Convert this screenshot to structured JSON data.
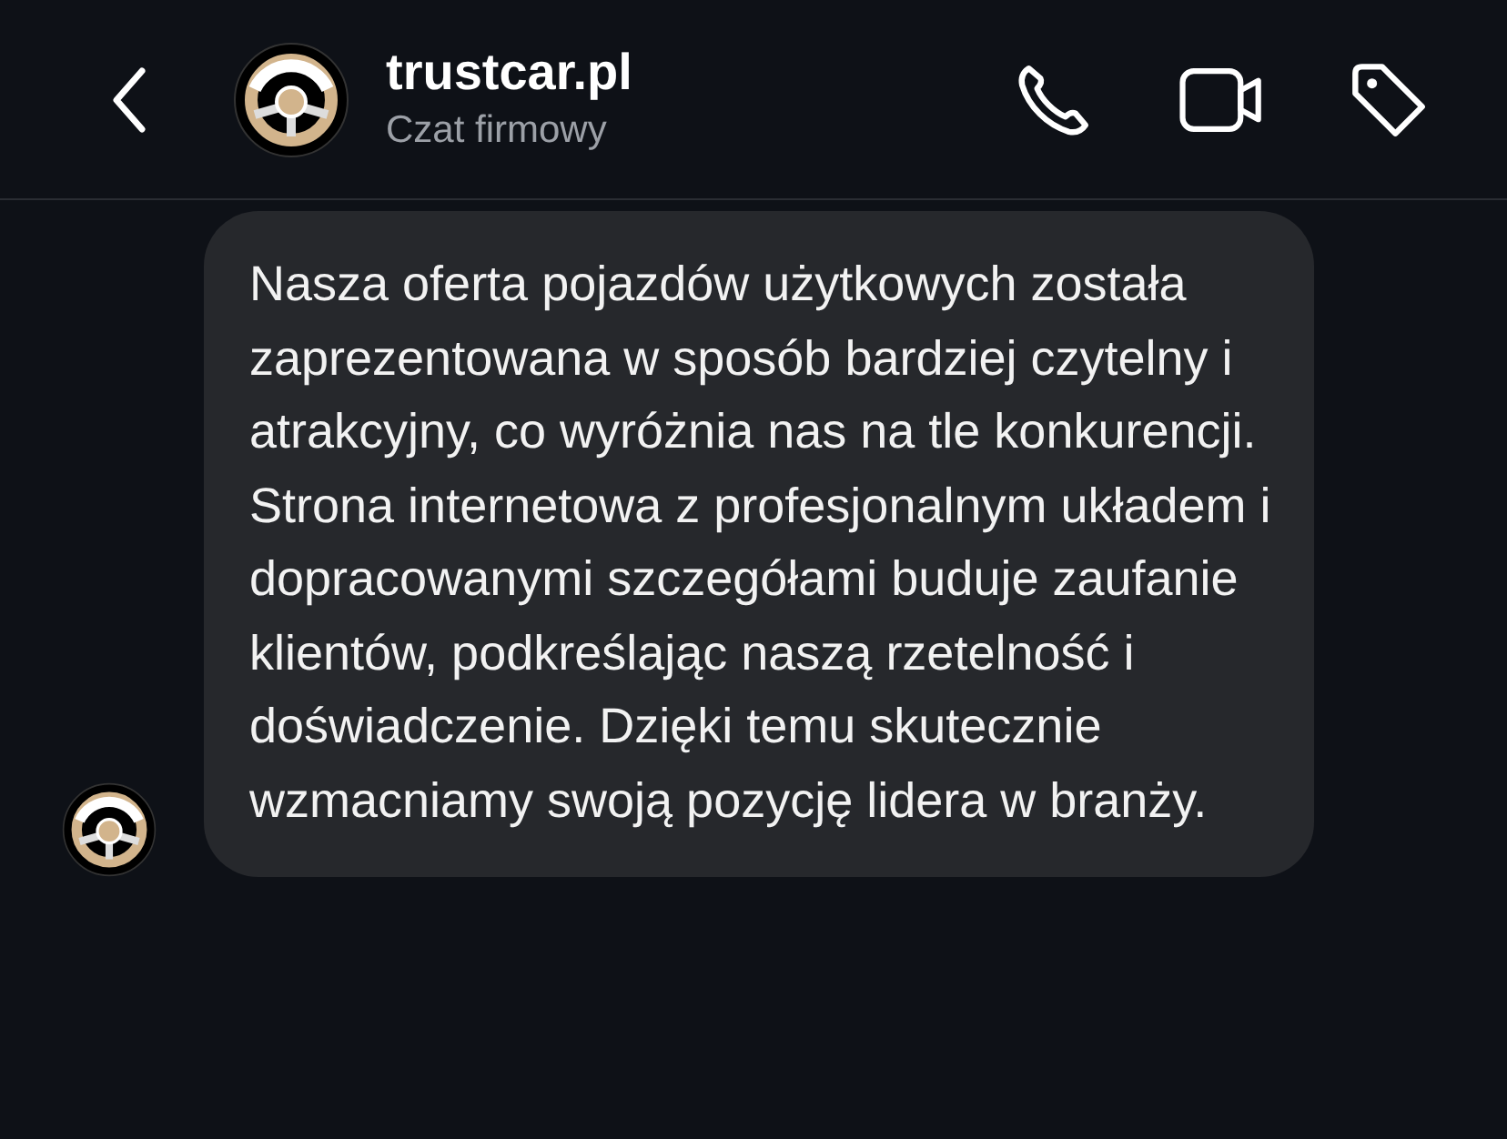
{
  "header": {
    "title": "trustcar.pl",
    "subtitle": "Czat firmowy"
  },
  "messages": [
    {
      "text": "Nasza oferta pojazdów użytkowych została zaprezentowana w sposób bardziej czytelny i atrakcyjny, co wyróżnia nas na tle konkurencji. Strona internetowa z profesjonalnym układem i dopracowanymi szczegółami buduje zaufanie klientów, podkreślając naszą rzetelność i doświadczenie. Dzięki temu skutecznie wzmacniamy swoją pozycję lidera w branży."
    }
  ]
}
